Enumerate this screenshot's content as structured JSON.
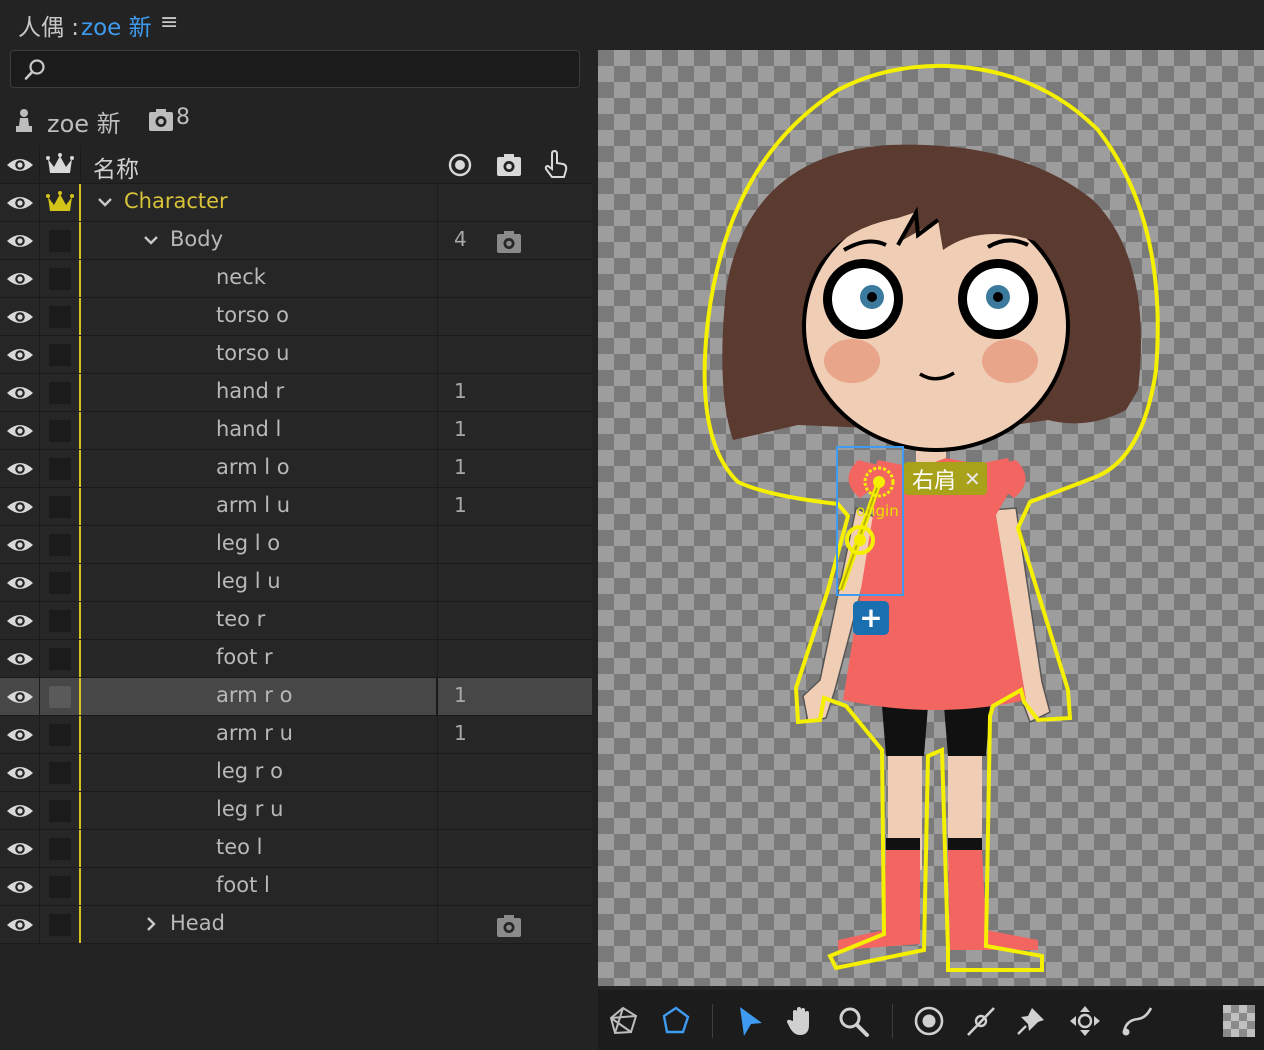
{
  "title": {
    "prefix": "人偶 :",
    "name": "zoe 新",
    "menu_icon": "hamburger-menu-icon"
  },
  "search": {
    "value": "",
    "placeholder": ""
  },
  "puppet": {
    "name": "zoe 新",
    "handle_count": "8"
  },
  "table": {
    "header": {
      "name": "名称"
    },
    "rows": [
      {
        "label": "Character",
        "count": "",
        "indent": 0,
        "expander": "expanded",
        "tagged": true,
        "camera": false,
        "selected": false
      },
      {
        "label": "Body",
        "count": "4",
        "indent": 1,
        "expander": "expanded",
        "tagged": false,
        "camera": true,
        "selected": false
      },
      {
        "label": "neck",
        "count": "",
        "indent": 2,
        "expander": "none",
        "tagged": false,
        "camera": false,
        "selected": false
      },
      {
        "label": "torso o",
        "count": "",
        "indent": 2,
        "expander": "none",
        "tagged": false,
        "camera": false,
        "selected": false
      },
      {
        "label": "torso u",
        "count": "",
        "indent": 2,
        "expander": "none",
        "tagged": false,
        "camera": false,
        "selected": false
      },
      {
        "label": "hand r",
        "count": "1",
        "indent": 2,
        "expander": "none",
        "tagged": false,
        "camera": false,
        "selected": false
      },
      {
        "label": "hand l",
        "count": "1",
        "indent": 2,
        "expander": "none",
        "tagged": false,
        "camera": false,
        "selected": false
      },
      {
        "label": "arm l o",
        "count": "1",
        "indent": 2,
        "expander": "none",
        "tagged": false,
        "camera": false,
        "selected": false
      },
      {
        "label": "arm l u",
        "count": "1",
        "indent": 2,
        "expander": "none",
        "tagged": false,
        "camera": false,
        "selected": false
      },
      {
        "label": "leg l o",
        "count": "",
        "indent": 2,
        "expander": "none",
        "tagged": false,
        "camera": false,
        "selected": false
      },
      {
        "label": "leg l u",
        "count": "",
        "indent": 2,
        "expander": "none",
        "tagged": false,
        "camera": false,
        "selected": false
      },
      {
        "label": "teo r",
        "count": "",
        "indent": 2,
        "expander": "none",
        "tagged": false,
        "camera": false,
        "selected": false
      },
      {
        "label": "foot r",
        "count": "",
        "indent": 2,
        "expander": "none",
        "tagged": false,
        "camera": false,
        "selected": false
      },
      {
        "label": "arm r o",
        "count": "1",
        "indent": 2,
        "expander": "none",
        "tagged": false,
        "camera": false,
        "selected": true
      },
      {
        "label": "arm r u",
        "count": "1",
        "indent": 2,
        "expander": "none",
        "tagged": false,
        "camera": false,
        "selected": false
      },
      {
        "label": "leg r o",
        "count": "",
        "indent": 2,
        "expander": "none",
        "tagged": false,
        "camera": false,
        "selected": false
      },
      {
        "label": "leg r u",
        "count": "",
        "indent": 2,
        "expander": "none",
        "tagged": false,
        "camera": false,
        "selected": false
      },
      {
        "label": "teo l",
        "count": "",
        "indent": 2,
        "expander": "none",
        "tagged": false,
        "camera": false,
        "selected": false
      },
      {
        "label": "foot l",
        "count": "",
        "indent": 2,
        "expander": "none",
        "tagged": false,
        "camera": false,
        "selected": false
      },
      {
        "label": "Head",
        "count": "",
        "indent": 1,
        "expander": "collapsed",
        "tagged": false,
        "camera": true,
        "selected": false
      }
    ]
  },
  "canvas": {
    "tag_label": "右肩",
    "handle_label": "origin",
    "outline_color": "#f5f000",
    "hair_color": "#5b3a30",
    "skin_color": "#f0cdb5",
    "dress_color": "#f26560"
  },
  "toolbar": {
    "tools": [
      "mesh-icon",
      "polygon-icon",
      "select-arrow-icon",
      "hand-icon",
      "zoom-icon",
      "origin-handle-icon",
      "pin-handle-icon",
      "stick-icon",
      "dragger-icon",
      "path-icon",
      "transparency-grid-icon"
    ],
    "active_tool": "select-arrow-icon"
  },
  "colors": {
    "accent": "#3e9bf0",
    "tag": "#d4c41a",
    "selection": "#474747"
  }
}
